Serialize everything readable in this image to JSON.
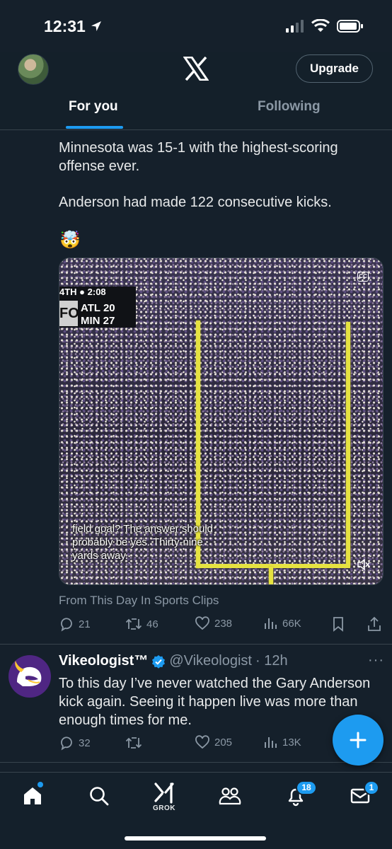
{
  "status_bar": {
    "time": "12:31"
  },
  "header": {
    "upgrade_label": "Upgrade",
    "tabs": [
      {
        "label": "For you",
        "active": true
      },
      {
        "label": "Following",
        "active": false
      }
    ]
  },
  "post": {
    "text_line_1": "Minnesota was 15-1 with the highest-scoring",
    "text_line_2": "offense ever.",
    "text_line_3": "Anderson had made 122 consecutive kicks.",
    "emoji": "🤯",
    "video": {
      "score_clock": "4TH ● 2:08",
      "network": "FOX",
      "team1": "ATL 20",
      "team2": "MIN 27",
      "cc_label": "CC",
      "caption_lines": [
        "field goal? The answer should",
        "probably be yes. Thirty-nine",
        "yards away."
      ]
    },
    "source": "From This Day In Sports Clips",
    "actions": {
      "replies": "21",
      "reposts": "46",
      "likes": "238",
      "views": "66K"
    }
  },
  "reply": {
    "name": "Vikeologist™",
    "handle": "@Vikeologist",
    "time": "· 12h",
    "text_lines": [
      "To this day I’ve never watched the Gary Anderson",
      "kick again.  Seeing it happen live was more than",
      "enough times for me."
    ],
    "actions": {
      "replies": "32",
      "reposts": "",
      "likes": "205",
      "views": "13K"
    }
  },
  "bottom_nav": {
    "grok_label": "GROK",
    "notifications_badge": "18",
    "messages_badge": "1"
  },
  "colors": {
    "background": "#15202b",
    "accent": "#1d9bf0",
    "muted": "#8b98a5"
  }
}
